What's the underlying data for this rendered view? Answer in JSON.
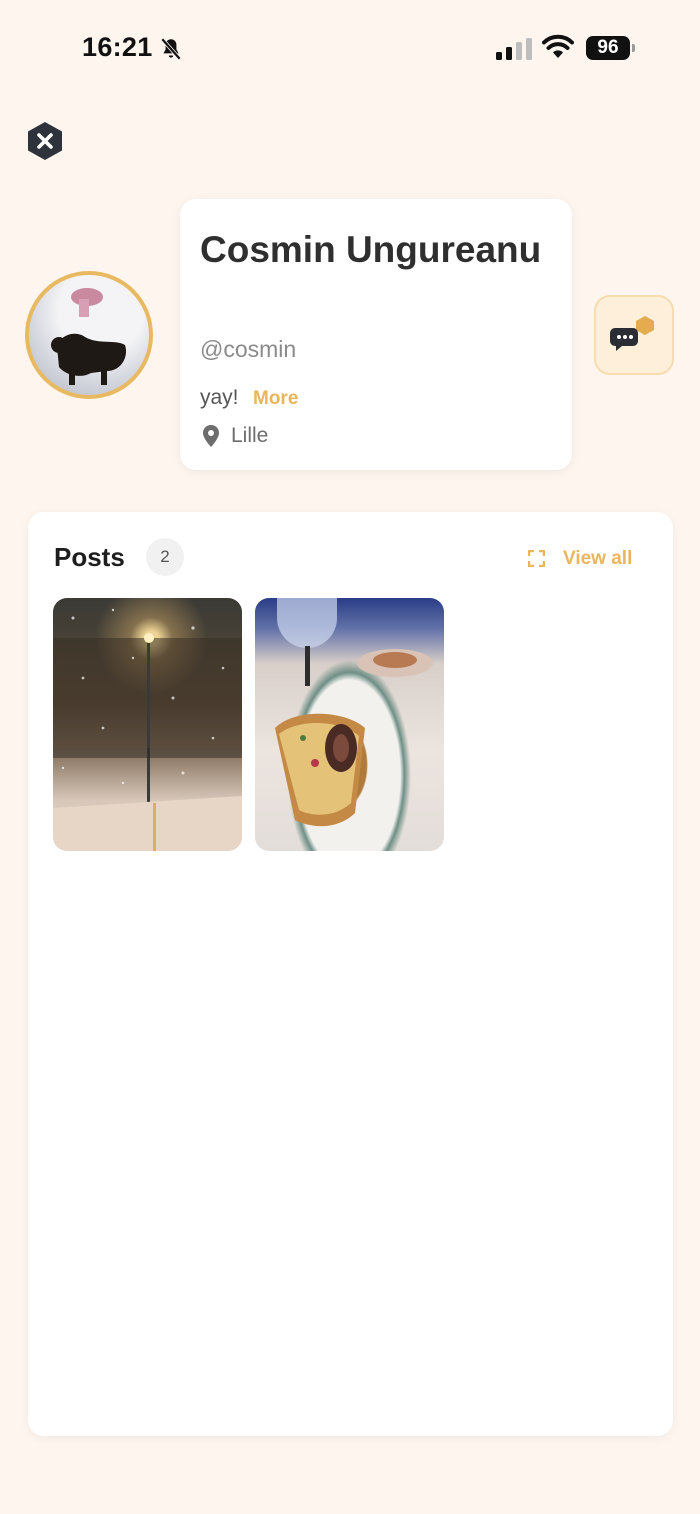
{
  "status_bar": {
    "time": "16:21",
    "battery": "96",
    "icons": [
      "bell-slash-icon",
      "cellular-signal-icon",
      "wifi-icon",
      "battery-icon"
    ]
  },
  "header": {
    "close_icon": "close-hexagon-icon"
  },
  "profile": {
    "name": "Cosmin Ungureanu",
    "handle": "@cosmin",
    "bio": "yay!",
    "more_label": "More",
    "location": "Lille",
    "avatar_icon": "avatar-photo"
  },
  "actions": {
    "chat_icon": "chat-bubbles-icon"
  },
  "posts": {
    "title": "Posts",
    "count": "2",
    "view_all_label": "View all",
    "items": [
      {
        "name": "snowy-street-night-photo"
      },
      {
        "name": "cake-slice-plate-photo"
      }
    ]
  },
  "colors": {
    "background": "#fdf5ee",
    "accent": "#e9b55d",
    "card": "#ffffff"
  }
}
